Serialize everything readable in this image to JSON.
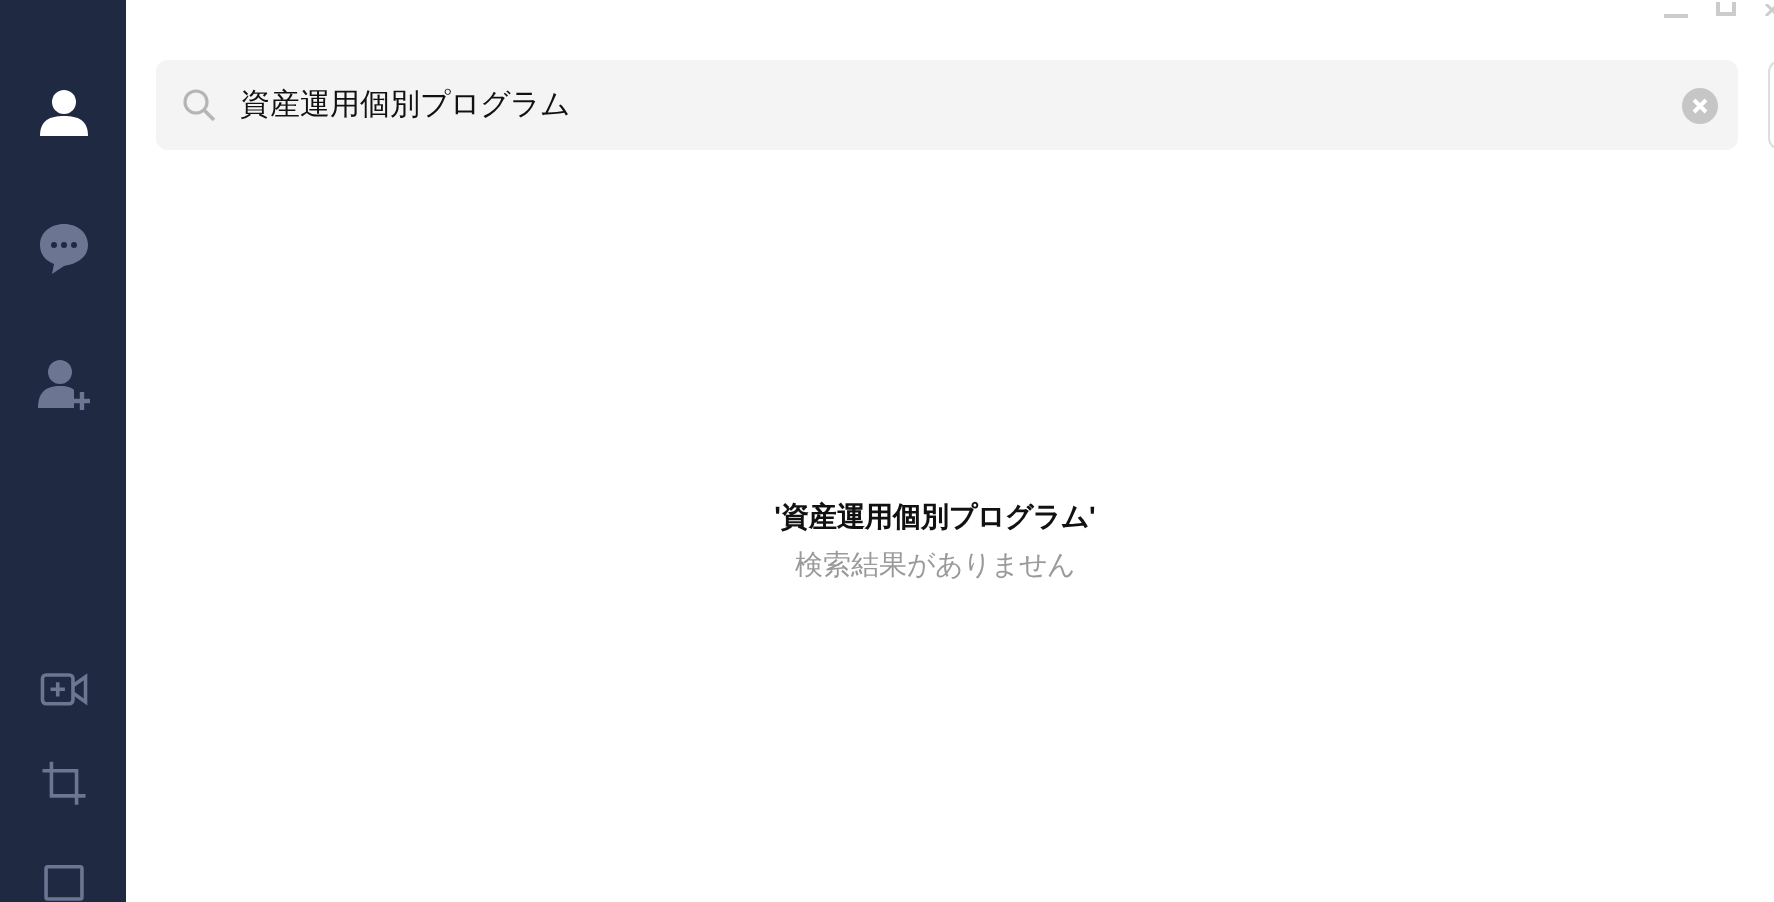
{
  "sidebar": {
    "items": [
      {
        "kind": "person",
        "selected": true
      },
      {
        "kind": "chat",
        "selected": false
      },
      {
        "kind": "add-person",
        "selected": false
      }
    ],
    "tools": [
      {
        "kind": "video-add"
      },
      {
        "kind": "crop"
      },
      {
        "kind": "box"
      }
    ]
  },
  "search": {
    "value": "資産運用個別プログラム"
  },
  "result": {
    "query": "'資産運用個別プログラム'",
    "message": "検索結果がありません"
  }
}
